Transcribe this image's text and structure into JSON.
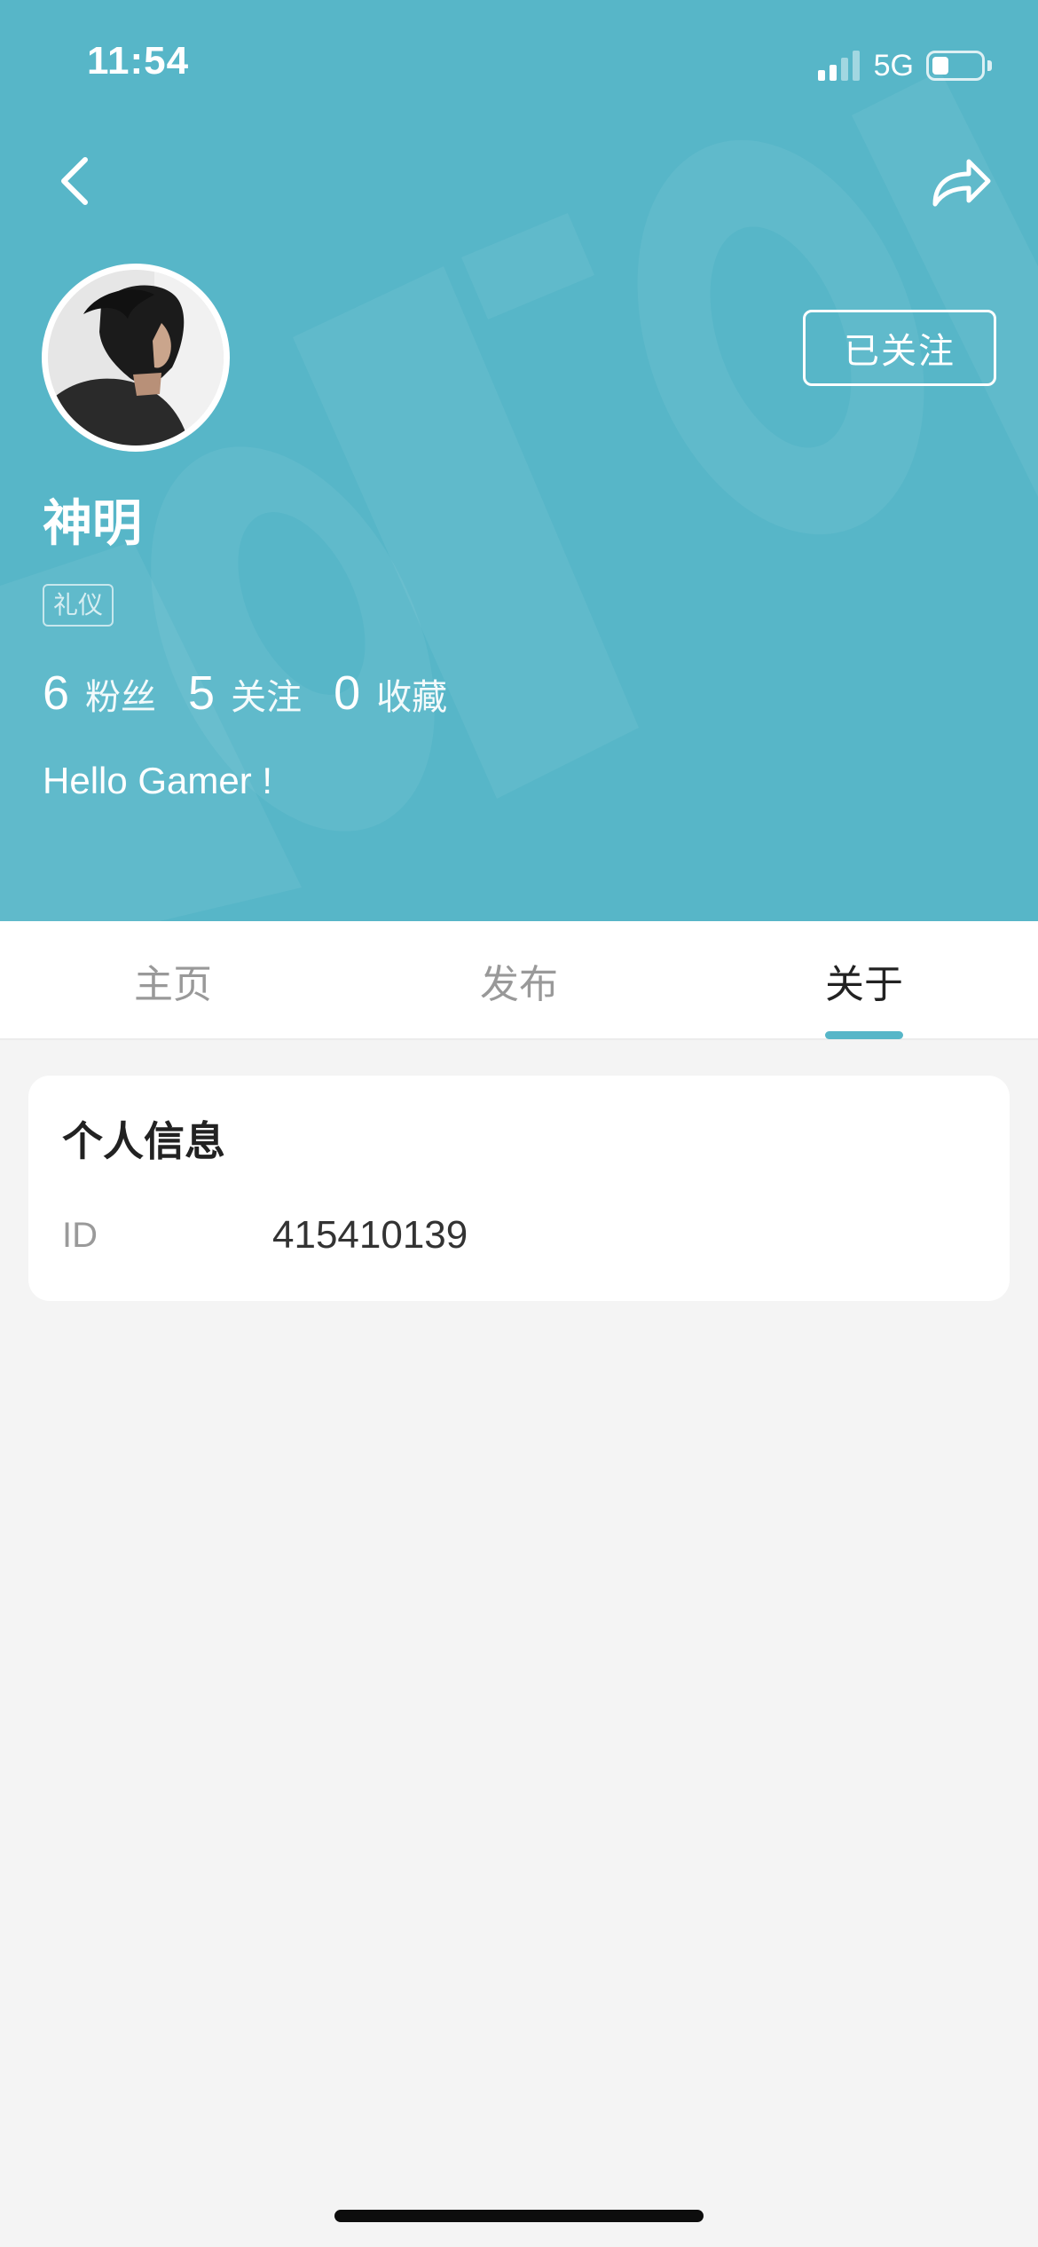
{
  "status_bar": {
    "time": "11:54",
    "network": "5G"
  },
  "colors": {
    "header_bg": "#57b6c8",
    "accent": "#57b6c8"
  },
  "nav": {
    "back_icon": "chevron-left-icon",
    "share_icon": "share-arrow-icon"
  },
  "profile": {
    "name": "神明",
    "follow_button": "已关注",
    "tag": "礼仪",
    "bio": "Hello Gamer !",
    "stats": [
      {
        "value": "6",
        "label": "粉丝"
      },
      {
        "value": "5",
        "label": "关注"
      },
      {
        "value": "0",
        "label": "收藏"
      }
    ]
  },
  "tabs": [
    {
      "label": "主页",
      "active": false
    },
    {
      "label": "发布",
      "active": false
    },
    {
      "label": "关于",
      "active": true
    }
  ],
  "about_card": {
    "title": "个人信息",
    "fields": [
      {
        "label": "ID",
        "value": "415410139"
      }
    ]
  }
}
